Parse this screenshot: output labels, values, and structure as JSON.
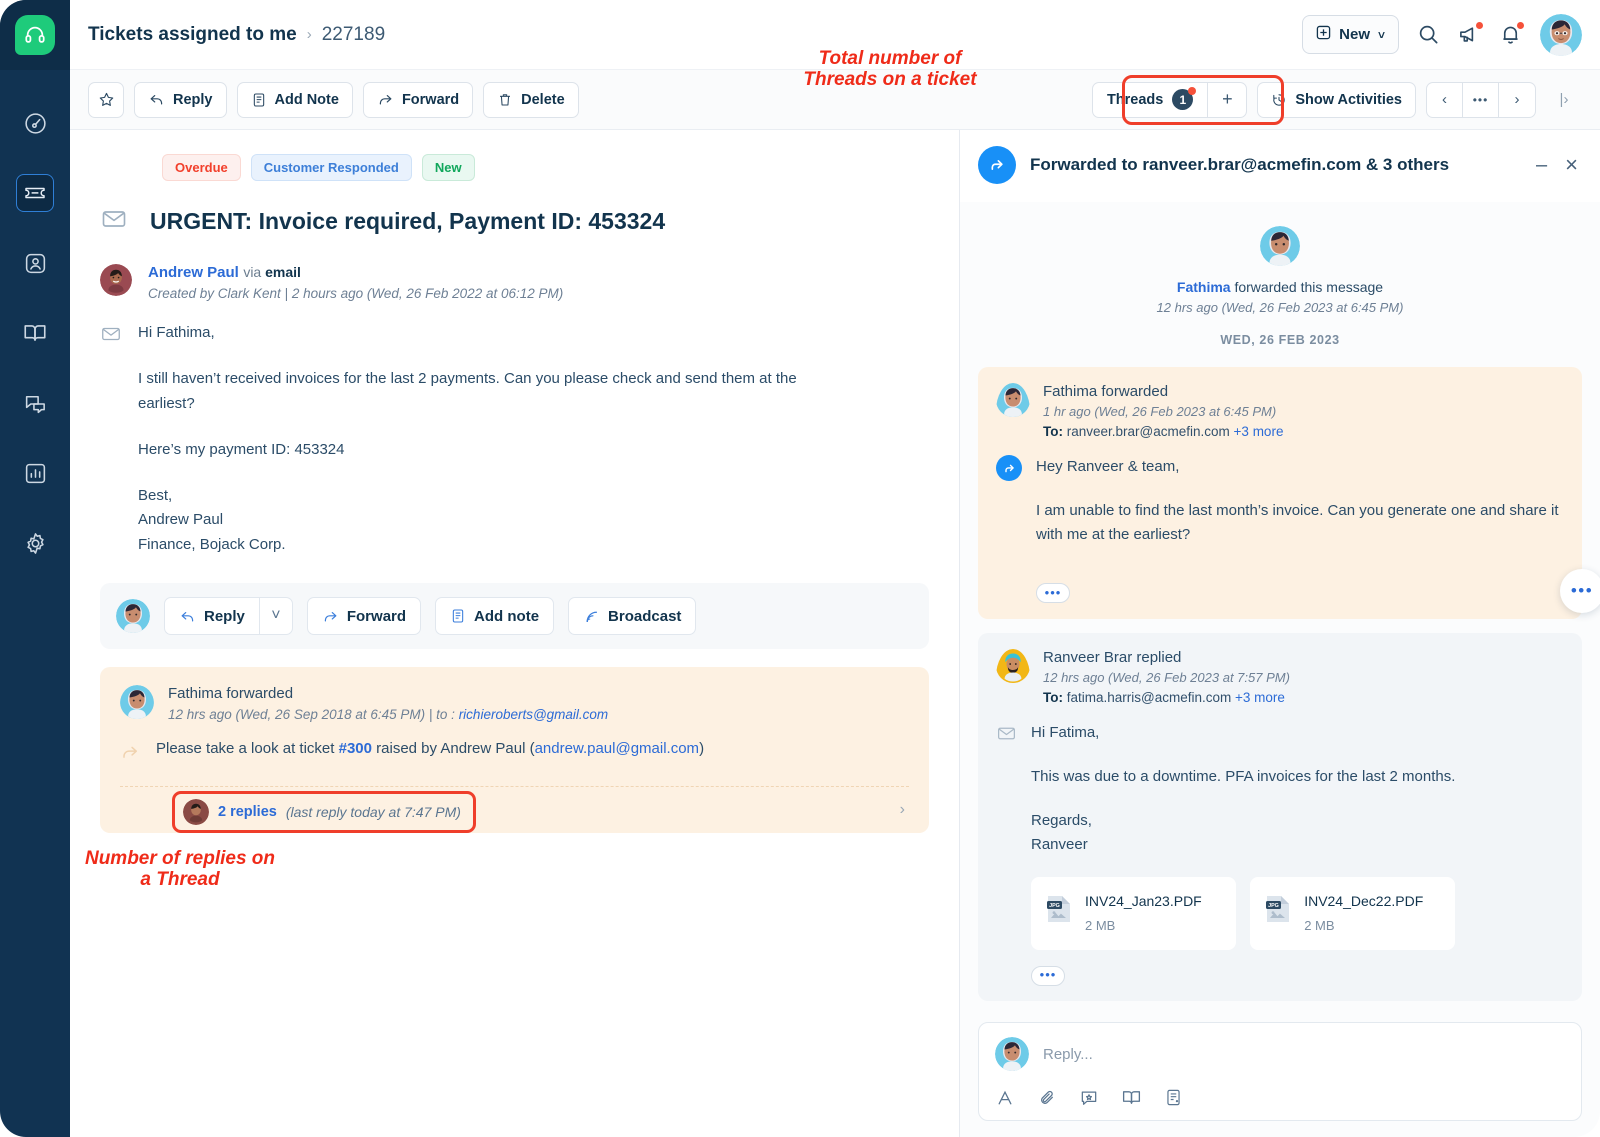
{
  "sidebar": {
    "logo_icon": "headset-logo",
    "items": [
      {
        "name": "dashboard",
        "icon": "speedometer-icon",
        "active": false
      },
      {
        "name": "tickets",
        "icon": "ticket-icon",
        "active": true
      },
      {
        "name": "contacts",
        "icon": "contact-card-icon",
        "active": false
      },
      {
        "name": "knowledge-base",
        "icon": "book-icon",
        "active": false
      },
      {
        "name": "chat",
        "icon": "chat-bubbles-icon",
        "active": false
      },
      {
        "name": "reports",
        "icon": "bar-chart-icon",
        "active": false
      },
      {
        "name": "settings",
        "icon": "gear-icon",
        "active": false
      }
    ]
  },
  "header": {
    "breadcrumb_parent": "Tickets assigned to me",
    "breadcrumb_separator": "›",
    "breadcrumb_current": "227189",
    "new_button": "New",
    "new_caret": "˅",
    "icons": [
      "search-icon",
      "announcement-icon",
      "bell-icon",
      "avatar"
    ]
  },
  "toolbar": {
    "star_label": "",
    "reply": "Reply",
    "add_note": "Add Note",
    "forward": "Forward",
    "delete": "Delete",
    "threads_label": "Threads",
    "threads_count": "1",
    "threads_plus": "+",
    "show_activities": "Show Activities",
    "nav_prev": "‹",
    "nav_more": "•••",
    "nav_next": "›",
    "collapse": "|›"
  },
  "annotations": {
    "threads": "Total number of\nThreads on a ticket",
    "replies": "Number of replies on\na Thread"
  },
  "ticket": {
    "tags": [
      {
        "label": "Overdue",
        "style": "overdue"
      },
      {
        "label": "Customer Responded",
        "style": "responded"
      },
      {
        "label": "New",
        "style": "new"
      }
    ],
    "subject": "URGENT: Invoice required, Payment ID: 453324",
    "sender_name": "Andrew Paul",
    "sender_via_prefix": "via",
    "sender_via_channel": "email",
    "sender_meta": "Created by Clark Kent | 2 hours ago (Wed, 26 Feb 2022 at 06:12 PM)",
    "body": [
      "Hi Fathima,",
      "I still haven’t received invoices for the last 2 payments. Can you please check and send them at the earliest?",
      "Here’s my payment ID: 453324",
      "Best,\nAndrew Paul\nFinance, Bojack Corp."
    ]
  },
  "reply_bar": {
    "reply": "Reply",
    "caret": "˅",
    "forward": "Forward",
    "add_note": "Add note",
    "broadcast": "Broadcast"
  },
  "forward_card": {
    "author": "Fathima",
    "action": "forwarded",
    "meta_time": "12 hrs ago (Wed, 26 Sep 2018 at 6:45 PM) | to : ",
    "meta_email": "richieroberts@gmail.com",
    "message_pre": "Please take a look at ticket ",
    "message_ticket": "#300",
    "message_mid": " raised by Andrew Paul (",
    "message_email": "andrew.paul@gmail.com",
    "message_post": ")",
    "replies_count": "2 replies",
    "replies_time": "(last reply today at 7:47 PM)",
    "chevron": "›"
  },
  "thread_panel": {
    "title": "Forwarded to ranveer.brar@acmefin.com & 3 others",
    "minimize": "–",
    "close": "×",
    "origin_author": "Fathima",
    "origin_action": " forwarded this message",
    "origin_time": "12 hrs ago (Wed, 26 Feb 2023 at 6:45 PM)",
    "origin_date": "WED, 26 FEB 2023",
    "messages": [
      {
        "author": "Fathima",
        "action": " forwarded",
        "time": "1 hr ago (Wed, 26 Feb 2023 at 6:45 PM)",
        "to_label": "To:",
        "to_value": "ranveer.brar@acmefin.com",
        "to_more": "+3 more",
        "icon": "forward-circle-icon",
        "paragraphs": [
          "Hey Ranveer & team,",
          "I am unable to find the last month’s invoice. Can you generate one and share it with me at the earliest?"
        ],
        "more_dots": "•••",
        "attachments": []
      },
      {
        "author": "Ranveer Brar",
        "action": " replied",
        "time": "12 hrs ago (Wed, 26 Feb 2023 at 7:57 PM)",
        "to_label": "To:",
        "to_value": "fatima.harris@acmefin.com",
        "to_more": "+3 more",
        "icon": "envelope-icon",
        "paragraphs": [
          "Hi Fatima,",
          "This was due to a downtime. PFA invoices for the last 2 months.",
          "Regards,\nRanveer"
        ],
        "more_dots": "•••",
        "attachments": [
          {
            "name": "INV24_Jan23.PDF",
            "size": "2 MB",
            "badge": "JPG"
          },
          {
            "name": "INV24_Dec22.PDF",
            "size": "2 MB",
            "badge": "JPG"
          }
        ]
      }
    ],
    "float_dots": "•••",
    "composer_placeholder": "Reply...",
    "composer_tools": [
      "format-text-icon",
      "attachment-icon",
      "canned-response-icon",
      "knowledge-base-icon",
      "template-icon"
    ]
  },
  "colors": {
    "sidebar": "#113352",
    "accent_blue": "#2c6bd6",
    "annotation_red": "#ef2b19",
    "forward_bg": "#fdf1e2",
    "reply_bg": "#f2f5f8"
  }
}
